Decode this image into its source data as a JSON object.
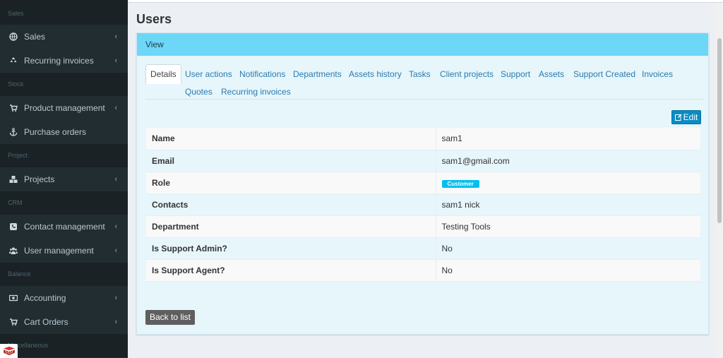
{
  "sidebar": {
    "sections": [
      {
        "header": "Sales",
        "items": [
          {
            "label": "Sales",
            "icon": "globe-icon",
            "has_children": true
          },
          {
            "label": "Recurring invoices",
            "icon": "recycle-icon",
            "has_children": true
          }
        ]
      },
      {
        "header": "Stock",
        "items": [
          {
            "label": "Product management",
            "icon": "cart-icon",
            "has_children": true
          },
          {
            "label": "Purchase orders",
            "icon": "anchor-icon",
            "has_children": false
          }
        ]
      },
      {
        "header": "Project",
        "items": [
          {
            "label": "Projects",
            "icon": "cubes-icon",
            "has_children": true
          }
        ]
      },
      {
        "header": "CRM",
        "items": [
          {
            "label": "Contact management",
            "icon": "phone-icon",
            "has_children": true
          },
          {
            "label": "User management",
            "icon": "users-icon",
            "has_children": true
          }
        ]
      },
      {
        "header": "Balance",
        "items": [
          {
            "label": "Accounting",
            "icon": "money-icon",
            "has_children": true
          },
          {
            "label": "Cart Orders",
            "icon": "cart-icon",
            "has_children": true
          }
        ]
      },
      {
        "header": "Miscellaneous",
        "items": []
      }
    ]
  },
  "page": {
    "title": "Users",
    "box_title": "View",
    "tabs": [
      "Details",
      "User actions",
      "Notifications",
      "Departments",
      "Assets history",
      "Tasks",
      "Client projects",
      "Support",
      "Assets",
      "Support Created",
      "Invoices",
      "Quotes",
      "Recurring invoices"
    ],
    "active_tab": "Details",
    "edit_label": "Edit",
    "back_label": "Back to list"
  },
  "details": [
    {
      "label": "Name",
      "value": "sam1"
    },
    {
      "label": "Email",
      "value": "sam1@gmail.com"
    },
    {
      "label": "Role",
      "value": "Customer",
      "badge": true
    },
    {
      "label": "Contacts",
      "value": "sam1 nick"
    },
    {
      "label": "Department",
      "value": "Testing Tools"
    },
    {
      "label": "Is Support Admin?",
      "value": "No"
    },
    {
      "label": "Is Support Agent?",
      "value": "No"
    }
  ],
  "colors": {
    "sidebar_bg": "#222d32",
    "box_header": "#6dd7f7",
    "badge": "#00c0ef",
    "edit_button": "#0b8bc4"
  }
}
